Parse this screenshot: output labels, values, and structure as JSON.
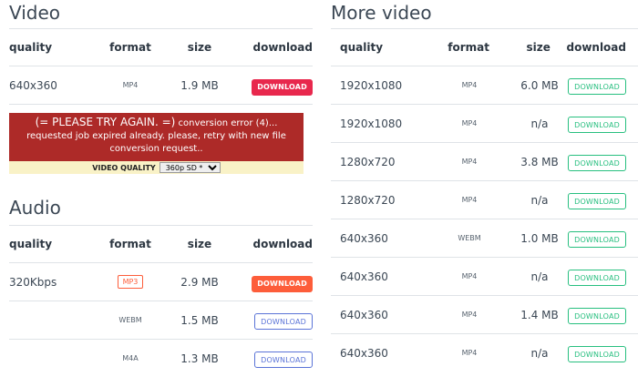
{
  "video": {
    "title": "Video",
    "headers": {
      "quality": "quality",
      "format": "format",
      "size": "size",
      "download": "download"
    },
    "rows": [
      {
        "quality": "640x360",
        "format": "MP4",
        "size": "1.9 MB",
        "button": "DOWNLOAD"
      }
    ]
  },
  "error": {
    "line1_big": "(= PLEASE TRY AGAIN. =)",
    "line1_rest": " conversion error (4)...",
    "line2": "requested job expired already. please, retry with new file",
    "line3": "conversion request.."
  },
  "video_quality": {
    "label": "VIDEO QUALITY",
    "selected": "360p SD *"
  },
  "audio": {
    "title": "Audio",
    "headers": {
      "quality": "quality",
      "format": "format",
      "size": "size",
      "download": "download"
    },
    "rows": [
      {
        "quality": "320Kbps",
        "format": "MP3",
        "size": "2.9 MB",
        "button": "DOWNLOAD"
      },
      {
        "quality": "",
        "format": "WEBM",
        "size": "1.5 MB",
        "button": "DOWNLOAD"
      },
      {
        "quality": "",
        "format": "M4A",
        "size": "1.3 MB",
        "button": "DOWNLOAD"
      }
    ]
  },
  "more_video": {
    "title": "More video",
    "headers": {
      "quality": "quality",
      "format": "format",
      "size": "size",
      "download": "download"
    },
    "rows": [
      {
        "quality": "1920x1080",
        "format": "MP4",
        "size": "6.0 MB",
        "button": "DOWNLOAD"
      },
      {
        "quality": "1920x1080",
        "format": "MP4",
        "size": "n/a",
        "button": "DOWNLOAD"
      },
      {
        "quality": "1280x720",
        "format": "MP4",
        "size": "3.8 MB",
        "button": "DOWNLOAD"
      },
      {
        "quality": "1280x720",
        "format": "MP4",
        "size": "n/a",
        "button": "DOWNLOAD"
      },
      {
        "quality": "640x360",
        "format": "WEBM",
        "size": "1.0 MB",
        "button": "DOWNLOAD"
      },
      {
        "quality": "640x360",
        "format": "MP4",
        "size": "n/a",
        "button": "DOWNLOAD"
      },
      {
        "quality": "640x360",
        "format": "MP4",
        "size": "1.4 MB",
        "button": "DOWNLOAD"
      },
      {
        "quality": "640x360",
        "format": "MP4",
        "size": "n/a",
        "button": "DOWNLOAD"
      }
    ]
  },
  "colors": {
    "error_bg": "#ad2a28",
    "video_button": "#e8284d",
    "audio_primary_button": "#fd5d3a",
    "audio_secondary_button": "#5a73d7",
    "more_video_button": "#27bf7f"
  }
}
